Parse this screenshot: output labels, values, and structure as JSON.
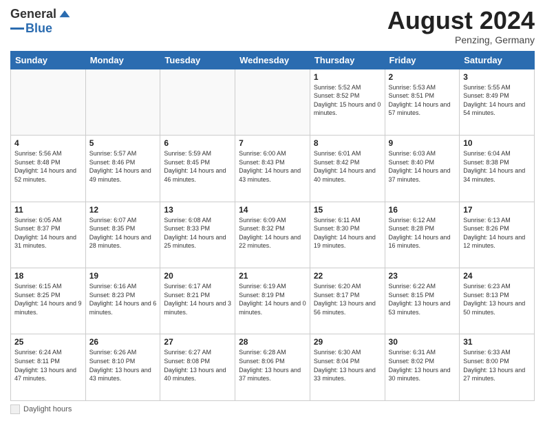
{
  "logo": {
    "general": "General",
    "blue": "Blue"
  },
  "title": "August 2024",
  "subtitle": "Penzing, Germany",
  "days_of_week": [
    "Sunday",
    "Monday",
    "Tuesday",
    "Wednesday",
    "Thursday",
    "Friday",
    "Saturday"
  ],
  "footer_label": "Daylight hours",
  "weeks": [
    [
      {
        "day": "",
        "info": ""
      },
      {
        "day": "",
        "info": ""
      },
      {
        "day": "",
        "info": ""
      },
      {
        "day": "",
        "info": ""
      },
      {
        "day": "1",
        "info": "Sunrise: 5:52 AM\nSunset: 8:52 PM\nDaylight: 15 hours and 0 minutes."
      },
      {
        "day": "2",
        "info": "Sunrise: 5:53 AM\nSunset: 8:51 PM\nDaylight: 14 hours and 57 minutes."
      },
      {
        "day": "3",
        "info": "Sunrise: 5:55 AM\nSunset: 8:49 PM\nDaylight: 14 hours and 54 minutes."
      }
    ],
    [
      {
        "day": "4",
        "info": "Sunrise: 5:56 AM\nSunset: 8:48 PM\nDaylight: 14 hours and 52 minutes."
      },
      {
        "day": "5",
        "info": "Sunrise: 5:57 AM\nSunset: 8:46 PM\nDaylight: 14 hours and 49 minutes."
      },
      {
        "day": "6",
        "info": "Sunrise: 5:59 AM\nSunset: 8:45 PM\nDaylight: 14 hours and 46 minutes."
      },
      {
        "day": "7",
        "info": "Sunrise: 6:00 AM\nSunset: 8:43 PM\nDaylight: 14 hours and 43 minutes."
      },
      {
        "day": "8",
        "info": "Sunrise: 6:01 AM\nSunset: 8:42 PM\nDaylight: 14 hours and 40 minutes."
      },
      {
        "day": "9",
        "info": "Sunrise: 6:03 AM\nSunset: 8:40 PM\nDaylight: 14 hours and 37 minutes."
      },
      {
        "day": "10",
        "info": "Sunrise: 6:04 AM\nSunset: 8:38 PM\nDaylight: 14 hours and 34 minutes."
      }
    ],
    [
      {
        "day": "11",
        "info": "Sunrise: 6:05 AM\nSunset: 8:37 PM\nDaylight: 14 hours and 31 minutes."
      },
      {
        "day": "12",
        "info": "Sunrise: 6:07 AM\nSunset: 8:35 PM\nDaylight: 14 hours and 28 minutes."
      },
      {
        "day": "13",
        "info": "Sunrise: 6:08 AM\nSunset: 8:33 PM\nDaylight: 14 hours and 25 minutes."
      },
      {
        "day": "14",
        "info": "Sunrise: 6:09 AM\nSunset: 8:32 PM\nDaylight: 14 hours and 22 minutes."
      },
      {
        "day": "15",
        "info": "Sunrise: 6:11 AM\nSunset: 8:30 PM\nDaylight: 14 hours and 19 minutes."
      },
      {
        "day": "16",
        "info": "Sunrise: 6:12 AM\nSunset: 8:28 PM\nDaylight: 14 hours and 16 minutes."
      },
      {
        "day": "17",
        "info": "Sunrise: 6:13 AM\nSunset: 8:26 PM\nDaylight: 14 hours and 12 minutes."
      }
    ],
    [
      {
        "day": "18",
        "info": "Sunrise: 6:15 AM\nSunset: 8:25 PM\nDaylight: 14 hours and 9 minutes."
      },
      {
        "day": "19",
        "info": "Sunrise: 6:16 AM\nSunset: 8:23 PM\nDaylight: 14 hours and 6 minutes."
      },
      {
        "day": "20",
        "info": "Sunrise: 6:17 AM\nSunset: 8:21 PM\nDaylight: 14 hours and 3 minutes."
      },
      {
        "day": "21",
        "info": "Sunrise: 6:19 AM\nSunset: 8:19 PM\nDaylight: 14 hours and 0 minutes."
      },
      {
        "day": "22",
        "info": "Sunrise: 6:20 AM\nSunset: 8:17 PM\nDaylight: 13 hours and 56 minutes."
      },
      {
        "day": "23",
        "info": "Sunrise: 6:22 AM\nSunset: 8:15 PM\nDaylight: 13 hours and 53 minutes."
      },
      {
        "day": "24",
        "info": "Sunrise: 6:23 AM\nSunset: 8:13 PM\nDaylight: 13 hours and 50 minutes."
      }
    ],
    [
      {
        "day": "25",
        "info": "Sunrise: 6:24 AM\nSunset: 8:11 PM\nDaylight: 13 hours and 47 minutes."
      },
      {
        "day": "26",
        "info": "Sunrise: 6:26 AM\nSunset: 8:10 PM\nDaylight: 13 hours and 43 minutes."
      },
      {
        "day": "27",
        "info": "Sunrise: 6:27 AM\nSunset: 8:08 PM\nDaylight: 13 hours and 40 minutes."
      },
      {
        "day": "28",
        "info": "Sunrise: 6:28 AM\nSunset: 8:06 PM\nDaylight: 13 hours and 37 minutes."
      },
      {
        "day": "29",
        "info": "Sunrise: 6:30 AM\nSunset: 8:04 PM\nDaylight: 13 hours and 33 minutes."
      },
      {
        "day": "30",
        "info": "Sunrise: 6:31 AM\nSunset: 8:02 PM\nDaylight: 13 hours and 30 minutes."
      },
      {
        "day": "31",
        "info": "Sunrise: 6:33 AM\nSunset: 8:00 PM\nDaylight: 13 hours and 27 minutes."
      }
    ]
  ]
}
